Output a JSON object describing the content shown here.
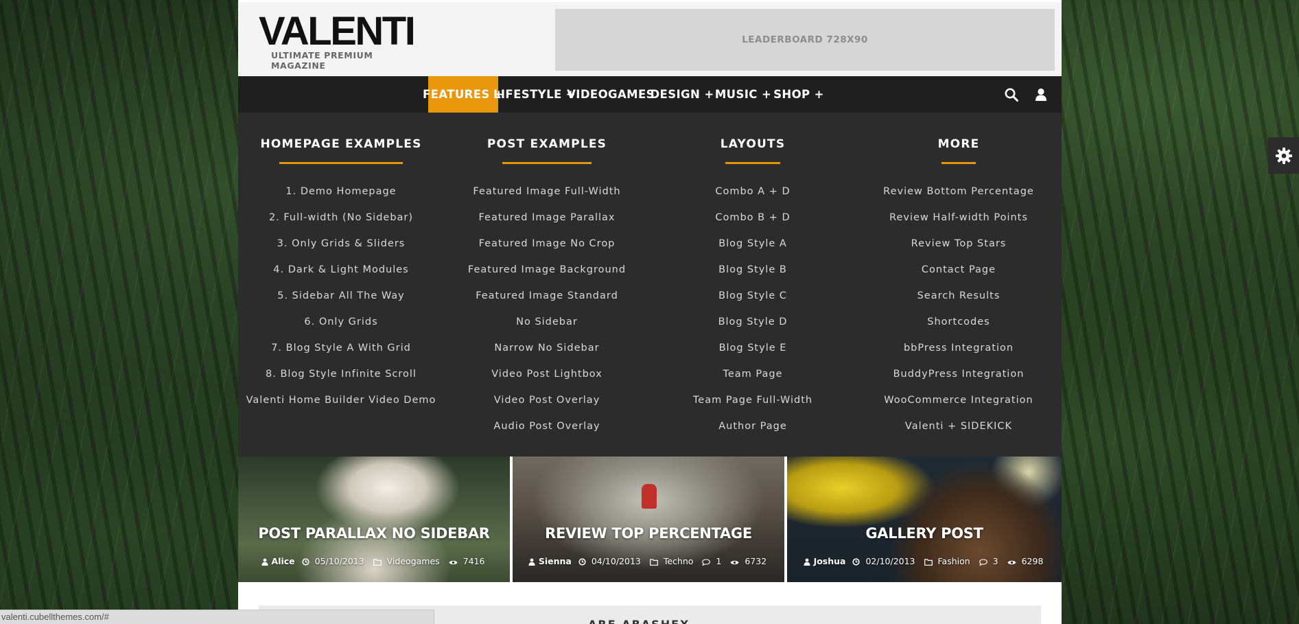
{
  "header": {
    "logo_title": "VALENTI",
    "logo_tagline": "ULTIMATE PREMIUM MAGAZINE",
    "leaderboard_label": "LEADERBOARD 728X90"
  },
  "nav": {
    "items": [
      {
        "label": "FEATURES +",
        "active": true
      },
      {
        "label": "LIFESTYLE +",
        "active": false
      },
      {
        "label": "VIDEOGAMES",
        "active": false
      },
      {
        "label": "DESIGN +",
        "active": false
      },
      {
        "label": "MUSIC +",
        "active": false
      },
      {
        "label": "SHOP +",
        "active": false
      }
    ],
    "icons": [
      "search-icon",
      "user-icon"
    ],
    "accent_color": "#e8960b"
  },
  "megamenu": {
    "columns": [
      {
        "heading": "HOMEPAGE EXAMPLES",
        "links": [
          "1. Demo Homepage",
          "2. Full-width (No Sidebar)",
          "3. Only Grids & Sliders",
          "4. Dark & Light Modules",
          "5. Sidebar All The Way",
          "6. Only Grids",
          "7. Blog Style A With Grid",
          "8. Blog Style Infinite Scroll",
          "Valenti Home Builder Video Demo"
        ]
      },
      {
        "heading": "POST EXAMPLES",
        "links": [
          "Featured Image Full-Width",
          "Featured Image Parallax",
          "Featured Image No Crop",
          "Featured Image Background",
          "Featured Image Standard",
          "No Sidebar",
          "Narrow No Sidebar",
          "Video Post Lightbox",
          "Video Post Overlay",
          "Audio Post Overlay"
        ]
      },
      {
        "heading": "LAYOUTS",
        "links": [
          "Combo A + D",
          "Combo B + D",
          "Blog Style A",
          "Blog Style B",
          "Blog Style C",
          "Blog Style D",
          "Blog Style E",
          "Team Page",
          "Team Page Full-Width",
          "Author Page"
        ]
      },
      {
        "heading": "MORE",
        "links": [
          "Review Bottom Percentage",
          "Review Half-width Points",
          "Review Top Stars",
          "Contact Page",
          "Search Results",
          "Shortcodes",
          "bbPress Integration",
          "BuddyPress Integration",
          "WooCommerce Integration",
          "Valenti + SIDEKICK"
        ]
      }
    ]
  },
  "cards": [
    {
      "title": "POST PARALLAX NO SIDEBAR",
      "author": "Alice",
      "date": "05/10/2013",
      "category": "Videogames",
      "comments": "",
      "views": "7416"
    },
    {
      "title": "REVIEW TOP PERCENTAGE",
      "author": "Sienna",
      "date": "04/10/2013",
      "category": "Techno",
      "comments": "1",
      "views": "6732"
    },
    {
      "title": "GALLERY POST",
      "author": "Joshua",
      "date": "02/10/2013",
      "category": "Fashion",
      "comments": "3",
      "views": "6298"
    }
  ],
  "below_section_text": "ARE ABASHEX",
  "status_url": "valenti.cubellthemes.com/#"
}
